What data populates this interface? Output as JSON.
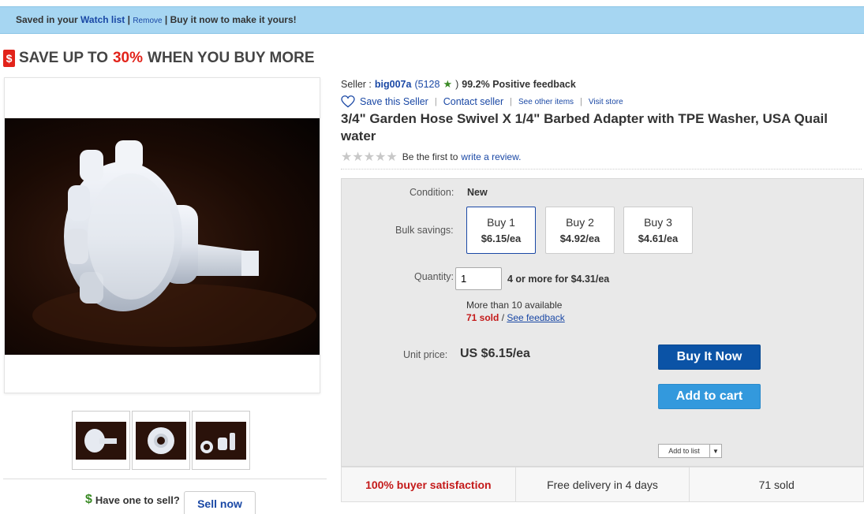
{
  "watch_bar": {
    "saved_prefix": "Saved in your",
    "watch_list_link": "Watch list",
    "separator_1": "|",
    "remove_link": "Remove",
    "separator_2": "|",
    "buy_now_text": "Buy it now to make it yours!"
  },
  "promo": {
    "icon": "dollar-tag-icon",
    "icon_glyph": "$",
    "prefix": "SAVE UP TO",
    "percent": "30%",
    "suffix": "WHEN YOU BUY MORE"
  },
  "gallery": {
    "main_image": "main-product-image",
    "thumbnails": [
      "thumbnail-adapter-side",
      "thumbnail-adapter-front",
      "thumbnail-adapter-parts"
    ]
  },
  "sell": {
    "icon_glyph": "$",
    "prompt": "Have one to sell?",
    "button": "Sell now"
  },
  "seller": {
    "label": "Seller :",
    "name": "big007a",
    "score_open": "(5128",
    "star": "★",
    "score_close": ")",
    "feedback": "99.2% Positive feedback",
    "save_seller": "Save this Seller",
    "sep1": "|",
    "contact": "Contact seller",
    "sep2": "|",
    "other_items": "See other items",
    "sep3": "|",
    "visit_store": "Visit store"
  },
  "product": {
    "title": "3/4\" Garden Hose Swivel X 1/4\" Barbed Adapter with TPE Washer, USA Quail water",
    "stars": "★★★★★",
    "review_prefix": "Be the first to",
    "review_link": "write a review."
  },
  "purchase": {
    "condition_label": "Condition:",
    "condition_value": "New",
    "bulk_label": "Bulk savings:",
    "bulk_options": [
      {
        "label": "Buy 1",
        "price": "$6.15/ea"
      },
      {
        "label": "Buy 2",
        "price": "$4.92/ea"
      },
      {
        "label": "Buy 3",
        "price": "$4.61/ea"
      }
    ],
    "bulk_selected_index": 0,
    "quantity_label": "Quantity:",
    "quantity_value": "1",
    "quantity_deal": "4 or more for $4.31/ea",
    "available": "More than 10 available",
    "sold": "71 sold",
    "sold_sep": " / ",
    "see_feedback": "See feedback",
    "unit_price_label": "Unit price:",
    "unit_price_value": "US $6.15/ea",
    "buy_now": "Buy It Now",
    "add_to_cart": "Add to cart",
    "add_to_list": "Add to list"
  },
  "stats": {
    "satisfaction": "100% buyer satisfaction",
    "delivery": "Free delivery in 4 days",
    "sold": "71 sold"
  },
  "colors": {
    "watch_bar_bg": "#a6d6f2",
    "link_blue": "#1a48a5",
    "promo_red": "#e2231a",
    "buy_now_bg": "#0b53a6",
    "add_to_cart_bg": "#3399dd",
    "feedback_star": "#3a8a25"
  }
}
